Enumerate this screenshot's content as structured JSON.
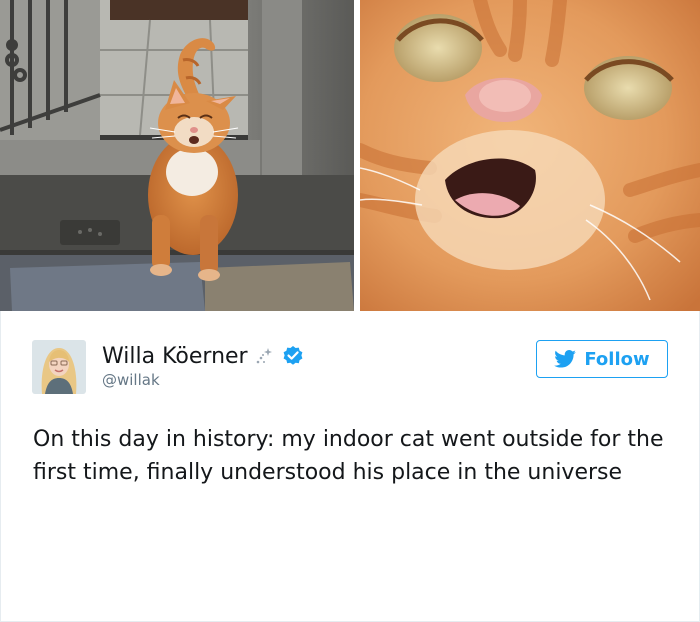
{
  "images": {
    "left_photo": "orange-tabby-cat-outside-photo",
    "right_photo": "orange-cat-face-closeup-photo"
  },
  "tweet": {
    "author_name": "Willa Köerner",
    "author_handle": "@willak",
    "follow_label": "Follow",
    "text": "On this day in history: my indoor cat went outside for the first time, finally understood his place in the universe"
  },
  "colors": {
    "twitter_blue": "#1da1f2",
    "text": "#14171a",
    "secondary_text": "#657786"
  }
}
